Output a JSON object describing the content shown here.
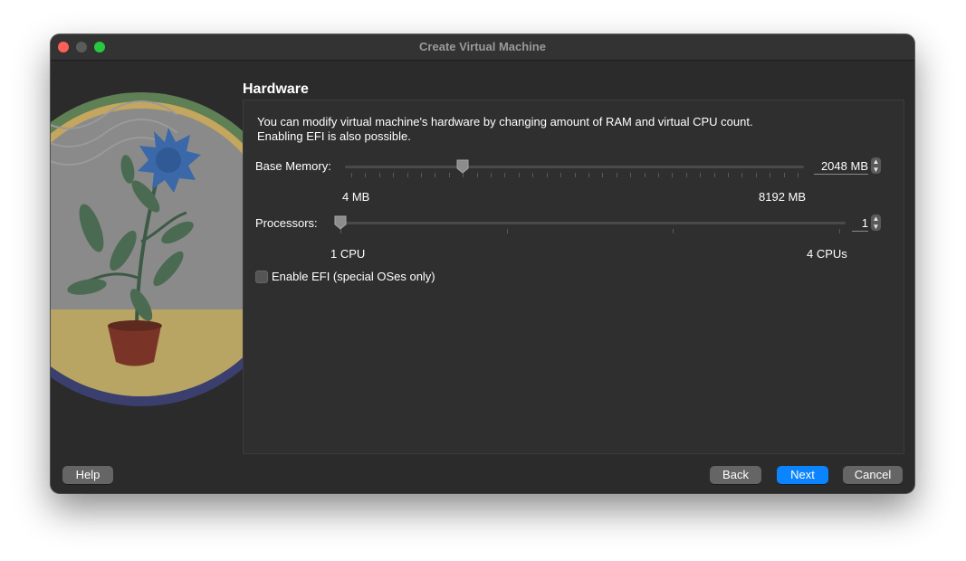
{
  "window": {
    "title": "Create Virtual Machine"
  },
  "page": {
    "section_title": "Hardware",
    "description_line1": "You can modify virtual machine's hardware by changing amount of RAM and virtual CPU count.",
    "description_line2": "Enabling EFI is also possible."
  },
  "memory": {
    "label": "Base Memory:",
    "min_label": "4 MB",
    "max_label": "8192 MB",
    "value_text": "2048 MB",
    "min": 4,
    "max": 8192,
    "value": 2048
  },
  "processors": {
    "label": "Processors:",
    "min_label": "1 CPU",
    "max_label": "4 CPUs",
    "value_text": "1",
    "min": 1,
    "max": 4,
    "value": 1
  },
  "efi": {
    "label": "Enable EFI (special OSes only)",
    "checked": false
  },
  "buttons": {
    "help": "Help",
    "back": "Back",
    "next": "Next",
    "cancel": "Cancel"
  },
  "colors": {
    "accent": "#0a84ff",
    "window_bg": "#2b2b2b",
    "close": "#fe5f57",
    "maximize": "#28c840"
  }
}
